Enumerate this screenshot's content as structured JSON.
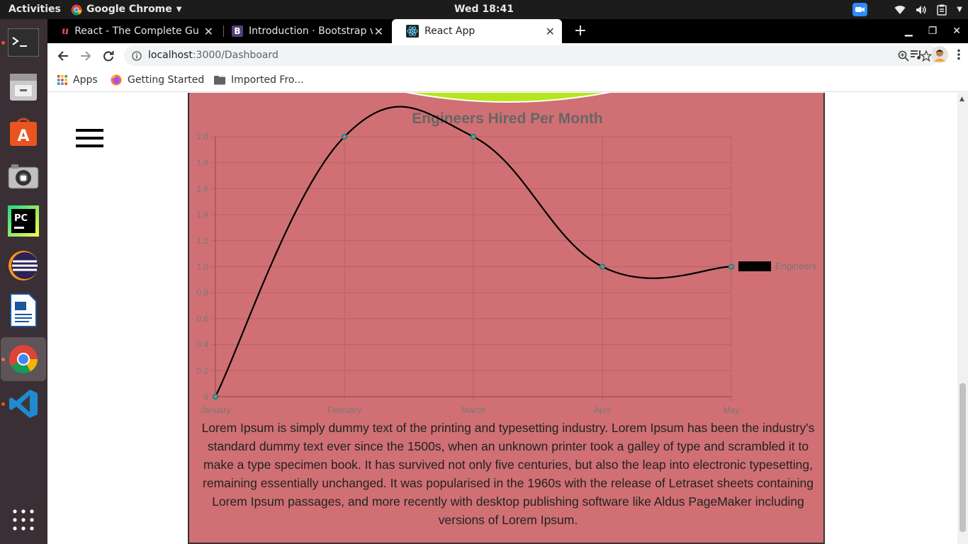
{
  "topbar": {
    "activities": "Activities",
    "app_name": "Google Chrome",
    "clock": "Wed 18:41"
  },
  "dock": {
    "items": [
      {
        "name": "terminal-icon"
      },
      {
        "name": "file-manager-icon"
      },
      {
        "name": "software-center-icon"
      },
      {
        "name": "camera-icon"
      },
      {
        "name": "pycharm-icon",
        "label": "PC"
      },
      {
        "name": "eclipse-icon"
      },
      {
        "name": "writer-icon"
      },
      {
        "name": "chrome-icon"
      },
      {
        "name": "vscode-icon"
      },
      {
        "name": "show-apps-icon"
      }
    ]
  },
  "tabs": [
    {
      "title": "React - The Complete Guide",
      "favicon": "udemy-icon"
    },
    {
      "title": "Introduction · Bootstrap v",
      "favicon": "bootstrap-icon"
    },
    {
      "title": "React App",
      "favicon": "react-icon"
    }
  ],
  "toolbar": {
    "url_host": "localhost",
    "url_path": ":3000/Dashboard"
  },
  "bookmarks": [
    {
      "label": "Apps",
      "icon": "apps-grid-icon"
    },
    {
      "label": "Getting Started",
      "icon": "firefox-icon"
    },
    {
      "label": "Imported Fro...",
      "icon": "folder-icon"
    }
  ],
  "page": {
    "paragraph": "Lorem Ipsum is simply dummy text of the printing and typesetting industry. Lorem Ipsum has been the industry's standard dummy text ever since the 1500s, when an unknown printer took a galley of type and scrambled it to make a type specimen book. It has survived not only five centuries, but also the leap into electronic typesetting, remaining essentially unchanged. It was popularised in the 1960s with the release of Letraset sheets containing Lorem Ipsum passages, and more recently with desktop publishing software like Aldus PageMaker including versions of Lorem Ipsum."
  },
  "colors": {
    "card_bg": "#d07074",
    "line": "#000000",
    "point_border": "#0e8a8a",
    "title": "#666666",
    "tick": "#777777",
    "grid": "#b86064",
    "pie_green": "#b5e61d"
  },
  "chart_data": {
    "type": "line",
    "title": "Engineers Hired Per Month",
    "categories": [
      "January",
      "February",
      "March",
      "April",
      "May"
    ],
    "series": [
      {
        "name": "Engineers",
        "values": [
          0,
          2,
          2,
          1,
          1
        ]
      }
    ],
    "ylim": [
      0,
      2
    ],
    "yticks": [
      "0",
      "0.2",
      "0.4",
      "0.6",
      "0.8",
      "1.0",
      "1.2",
      "1.4",
      "1.6",
      "1.8",
      "2.0"
    ],
    "grid": true,
    "legend_position": "right"
  }
}
